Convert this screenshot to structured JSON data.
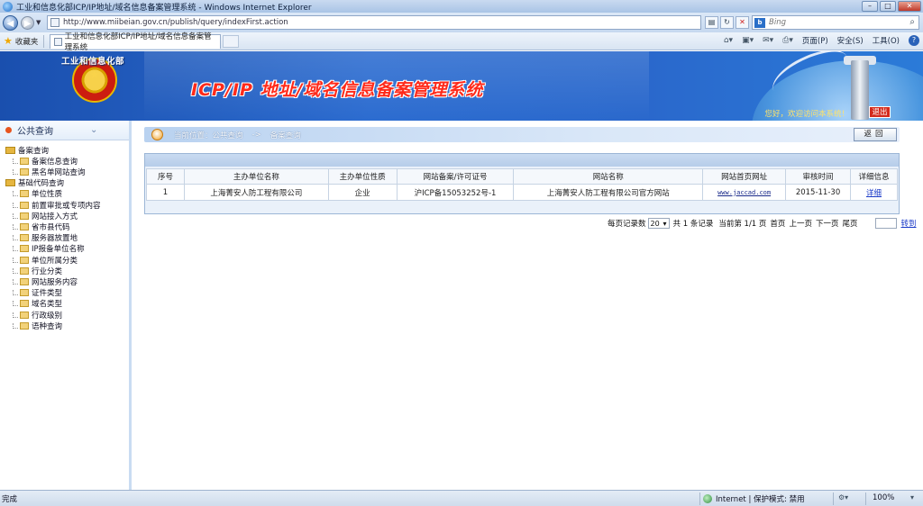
{
  "window": {
    "title": "工业和信息化部ICP/IP地址/域名信息备案管理系统 - Windows Internet Explorer",
    "buttons": {
      "minimize": "–",
      "maximize": "□",
      "close": "✕"
    }
  },
  "address_bar": {
    "url": "http://www.miibeian.gov.cn/publish/query/indexFirst.action",
    "search_placeholder": "Bing",
    "search_engine_icon": "b"
  },
  "favorites_bar": {
    "favorites_label": "收藏夹",
    "tab_title": "工业和信息化部ICP/IP地址/域名信息备案管理系统",
    "menus": [
      "页面(P)",
      "安全(S)",
      "工具(O)"
    ]
  },
  "banner": {
    "ministry_name": "工业和信息化部",
    "system_title": "ICP/IP 地址/域名信息备案管理系统",
    "welcome": "您好，欢迎访问本系统！",
    "logout_label": "退出"
  },
  "sidebar": {
    "header": "公共查询",
    "groups": [
      {
        "label": "备案查询",
        "items": [
          "备案信息查询",
          "黑名单网站查询"
        ]
      },
      {
        "label": "基础代码查询",
        "items": [
          "单位性质",
          "前置审批或专项内容",
          "网站接入方式",
          "省市县代码",
          "服务器放置地",
          "IP报备单位名称",
          "单位所属分类",
          "行业分类",
          "网站服务内容",
          "证件类型",
          "域名类型",
          "行政级别",
          "语种查询"
        ]
      }
    ]
  },
  "breadcrumb": {
    "prefix": "当前位置：",
    "section": "公共查询",
    "arrow": "->",
    "page": "备案查询"
  },
  "back_button": "返回",
  "results_table": {
    "columns": [
      "序号",
      "主办单位名称",
      "主办单位性质",
      "网站备案/许可证号",
      "网站名称",
      "网站首页网址",
      "审核时间",
      "详细信息"
    ],
    "rows": [
      {
        "index": "1",
        "organizer": "上海菁安人防工程有限公司",
        "organizer_type": "企业",
        "license": "沪ICP备15053252号-1",
        "site_name": "上海菁安人防工程有限公司官方网站",
        "homepage": "www.jaccad.com",
        "audit_date": "2015-11-30",
        "detail_link": "详细"
      }
    ]
  },
  "pager": {
    "per_page_label": "每页记录数",
    "per_page_value": "20",
    "total": "共 1 条记录",
    "current": "当前第 1/1 页",
    "first": "首页",
    "prev": "上一页",
    "next": "下一页",
    "last": "尾页",
    "go": "转到"
  },
  "status_bar": {
    "status": "完成",
    "zone": "Internet | 保护模式: 禁用",
    "zoom": "100%"
  }
}
